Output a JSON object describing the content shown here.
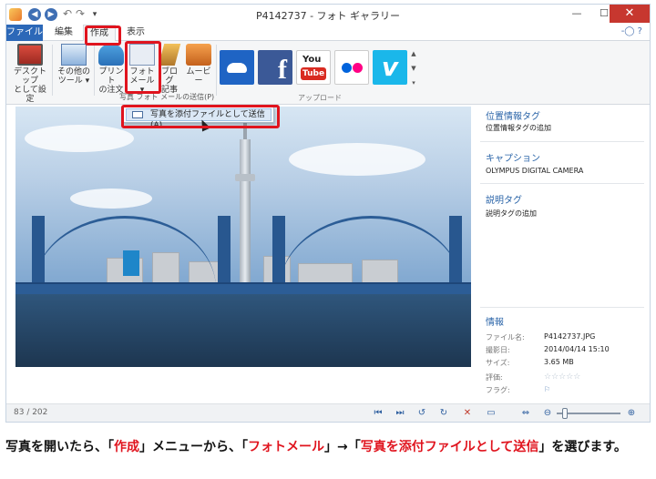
{
  "window": {
    "title": "P4142737 - フォト ギャラリー",
    "min": "—",
    "max": "☐",
    "close": "✕",
    "help": "-◯ ?"
  },
  "quick_access": {
    "more": "▾"
  },
  "tabs": [
    {
      "label": "ファイル"
    },
    {
      "label": "編集"
    },
    {
      "label": "作成"
    },
    {
      "label": "表示"
    }
  ],
  "ribbon": {
    "buttons": [
      {
        "label1": "デスクトップ",
        "label2": "として設定"
      },
      {
        "label1": "その他の",
        "label2": "ツール ▾"
      },
      {
        "label1": "プリント",
        "label2": "の注文"
      },
      {
        "label1": "フォト",
        "label2": "メール ▾"
      },
      {
        "label1": "ブログ",
        "label2": "記事"
      },
      {
        "label1": "ムービー",
        "label2": ""
      }
    ],
    "services": [
      {
        "name": "onedrive-icon"
      },
      {
        "name": "facebook-icon",
        "glyph": "f"
      },
      {
        "name": "youtube-icon",
        "text1": "You",
        "text2": "Tube"
      },
      {
        "name": "flickr-icon"
      },
      {
        "name": "vimeo-icon",
        "glyph": "v"
      }
    ],
    "group_share": "アップロード",
    "menu_strip": "写真   フォト メールの送信(P)"
  },
  "dropdown": {
    "item": "写真を添付ファイルとして送信(A)"
  },
  "details": {
    "geotag_heading": "位置情報タグ",
    "geotag_value": "位置情報タグの追加",
    "caption_heading": "キャプション",
    "caption_value": "OLYMPUS DIGITAL CAMERA",
    "desctag_heading": "説明タグ",
    "desctag_value": "説明タグの追加",
    "info_heading": "情報",
    "rows": [
      {
        "k": "ファイル名:",
        "v": "P4142737.JPG"
      },
      {
        "k": "撮影日:",
        "v": "2014/04/14  15:10"
      },
      {
        "k": "サイズ:",
        "v": "3.65 MB"
      },
      {
        "k": "評価:",
        "v": ""
      },
      {
        "k": "フラグ:",
        "v": ""
      }
    ],
    "rating_stars": "☆☆☆☆☆",
    "flag_glyph": "⚐"
  },
  "status": {
    "counter": "83 / 202",
    "zoom_max": "⊕",
    "zoom_min": "⊖"
  },
  "caption": {
    "p1": "写真を開いたら、「",
    "h1": "作成",
    "p2": "」メニューから、「",
    "h2": "フォトメール",
    "p3": "」→「",
    "h3": "写真を添付ファイルとして送信",
    "p4": "」を選びます。"
  }
}
